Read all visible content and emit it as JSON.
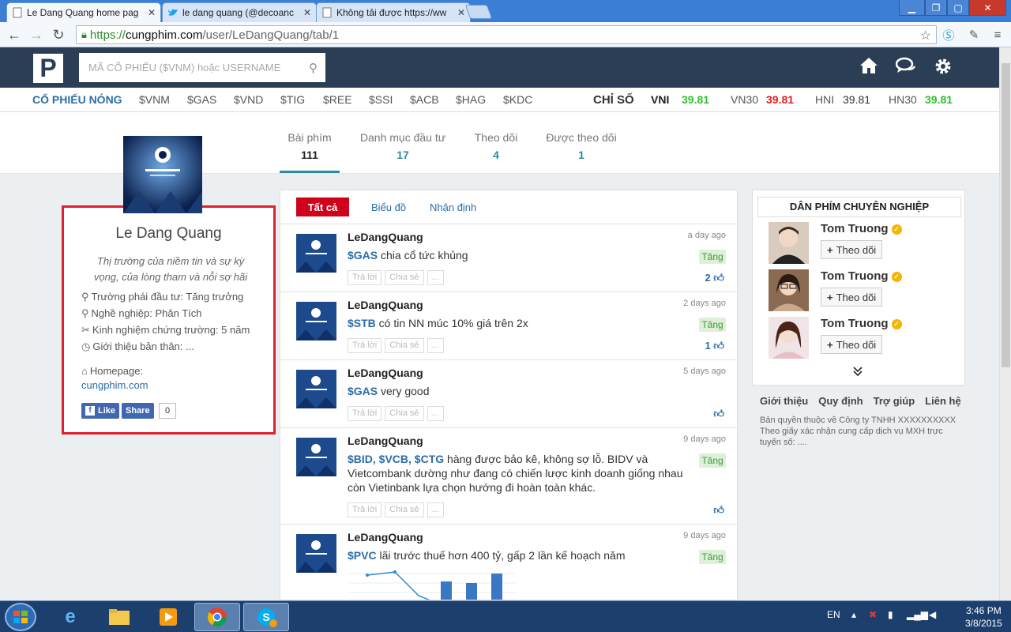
{
  "browser": {
    "tabs": [
      {
        "title": "Le Dang Quang home pag",
        "icon": "page-icon"
      },
      {
        "title": "le dang quang (@decoanc",
        "icon": "twitter-icon"
      },
      {
        "title": "Không tải được https://ww",
        "icon": "page-icon"
      }
    ],
    "url_https": "https://",
    "url_host": "cungphim.com",
    "url_path": "/user/LeDangQuang/tab/1"
  },
  "header": {
    "logo": "P",
    "search_placeholder": "MÃ CỔ PHIẾU ($VNM) hoặc USERNAME"
  },
  "ticker": {
    "hot_label": "CỔ PHIẾU NÓNG",
    "tickers": [
      "$VNM",
      "$GAS",
      "$VND",
      "$TIG",
      "$REE",
      "$SSI",
      "$ACB",
      "$HAG",
      "$KDC"
    ],
    "index_label": "CHỈ SỐ",
    "indices": [
      {
        "name": "VNI",
        "value": "39.81",
        "color": "#2fbf2f"
      },
      {
        "name": "VN30",
        "value": "39.81",
        "color": "#e02020"
      },
      {
        "name": "HNI",
        "value": "39.81",
        "color": "#333333"
      },
      {
        "name": "HN30",
        "value": "39.81",
        "color": "#2fbf2f"
      }
    ]
  },
  "profile_tabs": [
    {
      "label": "Bài phím",
      "count": "111"
    },
    {
      "label": "Danh mục đầu tư",
      "count": "17"
    },
    {
      "label": "Theo dõi",
      "count": "4"
    },
    {
      "label": "Được theo dõi",
      "count": "1"
    }
  ],
  "profile": {
    "name": "Le Dang Quang",
    "quote": "Thị trường của niềm tin và sự kỳ vọng, của lòng tham và nỗi sợ hãi",
    "info": [
      "Trường phái đầu tư: Tăng trưởng",
      "Nghề nghiệp: Phân Tích",
      "Kinh nghiệm chứng trường: 5 năm",
      "Giới thiệu bản thân: ..."
    ],
    "homepage_label": "Homepage:",
    "homepage_link": "cungphim.com",
    "fb_like": "Like",
    "fb_share": "Share",
    "fb_count": "0"
  },
  "feed": {
    "filters": [
      "Tất cả",
      "Biểu đồ",
      "Nhận định"
    ],
    "actions": [
      "Trả lời",
      "Chia sẻ",
      "..."
    ],
    "posts": [
      {
        "author": "LeDangQuang",
        "time": "a day ago",
        "ticker": "$GAS",
        "text": " chia cổ tức khủng",
        "tag": "Tăng",
        "likes": "2"
      },
      {
        "author": "LeDangQuang",
        "time": "2 days ago",
        "ticker": "$STB",
        "text": " có tin NN múc 10% giá trên 2x",
        "tag": "Tăng",
        "likes": "1"
      },
      {
        "author": "LeDangQuang",
        "time": "5 days ago",
        "ticker": "$GAS",
        "text": " very good",
        "tag": "",
        "likes": ""
      },
      {
        "author": "LeDangQuang",
        "time": "9 days ago",
        "ticker": "$BID, $VCB, $CTG",
        "text": " hàng được bảo kê, không sợ lỗ. BIDV và Vietcombank dường như đang có chiến lược kinh doanh giống nhau còn Vietinbank lựa chọn hướng đi hoàn toàn khác.",
        "tag": "Tăng",
        "likes": ""
      },
      {
        "author": "LeDangQuang",
        "time": "9 days ago",
        "ticker": "$PVC",
        "text": " lãi trước thuế hơn 400 tỷ, gấp 2 lần kế hoạch năm",
        "tag": "Tăng",
        "likes": ""
      }
    ]
  },
  "sidebar": {
    "title": "DÂN PHÍM CHUYÊN NGHIỆP",
    "follow_label": "Theo dõi",
    "traders": [
      {
        "name": "Tom Truong"
      },
      {
        "name": "Tom Truong"
      },
      {
        "name": "Tom Truong"
      }
    ],
    "footer_links": [
      "Giới thiệu",
      "Quy định",
      "Trợ giúp",
      "Liên hệ"
    ],
    "footnote": "Bản quyền thuộc về Công ty TNHH XXXXXXXXXX Theo giấy xác nhận cung cấp dịch vụ MXH trực tuyến số: ...."
  },
  "taskbar": {
    "lang": "EN",
    "time": "3:46 PM",
    "date": "3/8/2015"
  }
}
